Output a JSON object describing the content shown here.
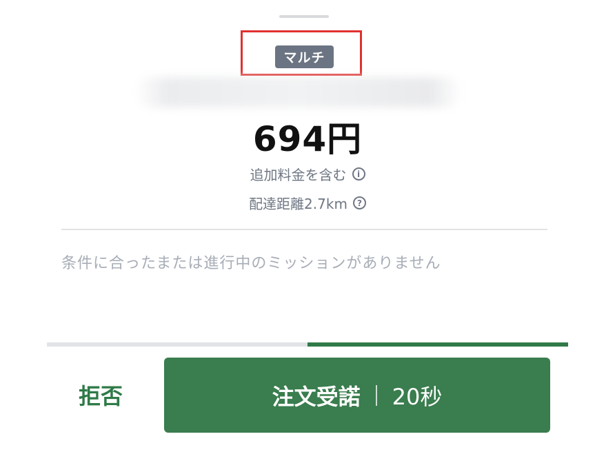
{
  "sheet": {
    "tag": "マルチ",
    "price": "694円",
    "fee_note": "追加料金を含む",
    "fee_icon": "info-icon",
    "distance": "配達距離2.7km",
    "distance_icon": "help-icon",
    "mission_status": "条件に合ったまたは進行中のミッションがありません"
  },
  "timer": {
    "remaining_fraction": 0.5
  },
  "actions": {
    "reject_label": "拒否",
    "accept_label": "注文受諾",
    "accept_timer": "20秒"
  },
  "colors": {
    "accent_green": "#3a7d4e",
    "highlight_red": "#e0302e",
    "badge_gray": "#6b7482"
  }
}
